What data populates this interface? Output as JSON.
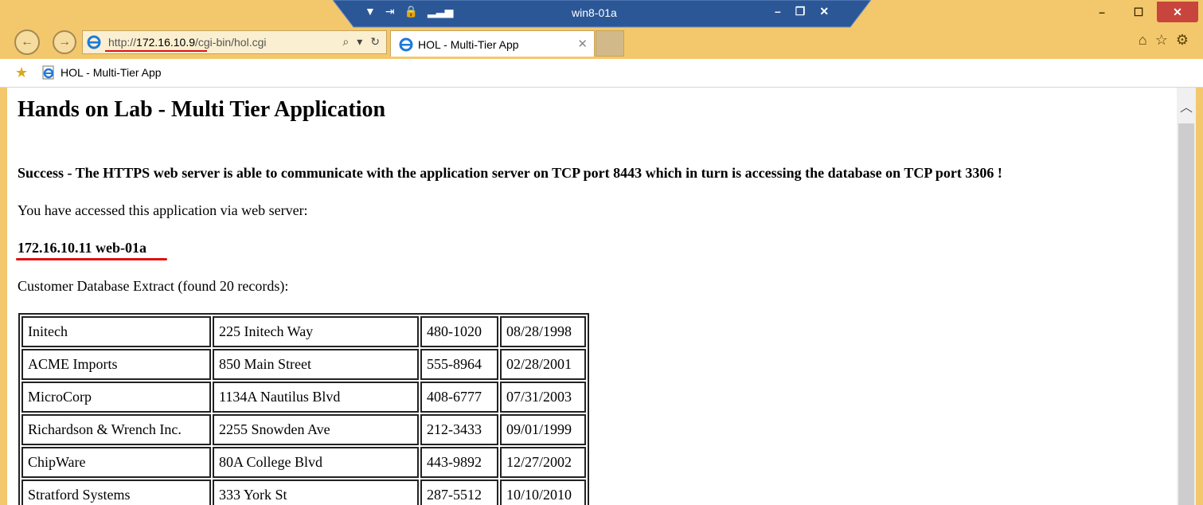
{
  "window": {
    "remote_title": "win8-01a",
    "min": "–",
    "max": "☐",
    "close": "✕"
  },
  "address": {
    "scheme": "http://",
    "host": "172.16.10.9",
    "path": "/cgi-bin/hol.cgi"
  },
  "tab": {
    "label": "HOL - Multi-Tier App",
    "close": "✕"
  },
  "favorites": {
    "item": "HOL - Multi-Tier App"
  },
  "page": {
    "title": "Hands on Lab - Multi Tier Application",
    "success": "Success - The HTTPS web server is able to communicate with the application server on TCP port 8443 which in turn is accessing the database on TCP port 3306 !",
    "accessed": "You have accessed this application via web server:",
    "server": "172.16.10.11 web-01a",
    "extract": "Customer Database Extract (found 20 records):"
  },
  "customers": [
    [
      "Initech",
      "225 Initech Way",
      "480-1020",
      "08/28/1998"
    ],
    [
      "ACME Imports",
      "850 Main Street",
      "555-8964",
      "02/28/2001"
    ],
    [
      "MicroCorp",
      "1134A Nautilus Blvd",
      "408-6777",
      "07/31/2003"
    ],
    [
      "Richardson & Wrench Inc.",
      "2255 Snowden Ave",
      "212-3433",
      "09/01/1999"
    ],
    [
      "ChipWare",
      "80A College Blvd",
      "443-9892",
      "12/27/2002"
    ],
    [
      "Stratford Systems",
      "333 York St",
      "287-5512",
      "10/10/2010"
    ]
  ]
}
